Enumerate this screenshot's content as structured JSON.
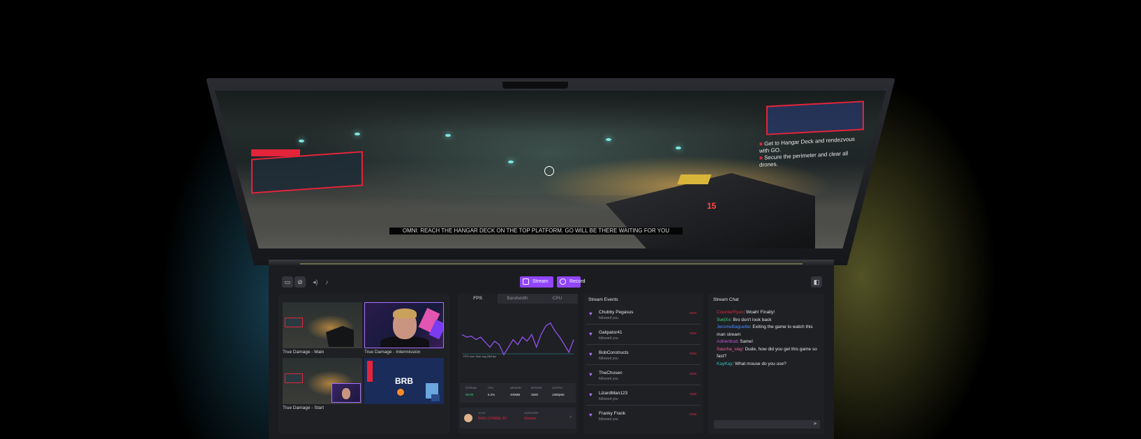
{
  "toolbar": {
    "stream_label": "Stream",
    "record_label": "Record",
    "accent": "#9146ff"
  },
  "game": {
    "hud_objectives": [
      "Get to Hangar Deck and rendezvous with GO.",
      "Secure the perimeter and clear all drones."
    ],
    "ammo": "15",
    "subtitle": "OMNI: REACH THE HANGAR DECK ON THE TOP PLATFORM. GO WILL BE THERE WAITING FOR YOU"
  },
  "scenes": [
    {
      "label": "True Damage - Main",
      "selected": false
    },
    {
      "label": "True Damage - Intermission",
      "selected": true
    },
    {
      "label": "True Damage - Start",
      "selected": false
    },
    {
      "label": "",
      "selected": false,
      "thumb_text": "BRB"
    }
  ],
  "stats": {
    "tabs": [
      "FPS",
      "Bandwidth",
      "CPU"
    ],
    "active_tab": "FPS",
    "graph_note": "FPS over time avg 288 fps",
    "fps_series": [
      0.55,
      0.5,
      0.52,
      0.45,
      0.5,
      0.4,
      0.3,
      0.42,
      0.35,
      0.15,
      0.3,
      0.45,
      0.35,
      0.5,
      0.42,
      0.55,
      0.3,
      0.55,
      0.72,
      0.78,
      0.62,
      0.5,
      0.35,
      0.2,
      0.45
    ],
    "metrics": [
      {
        "key": "Stream",
        "value": "00:00",
        "green": true
      },
      {
        "key": "CPU",
        "value": "5.2%",
        "green": false
      },
      {
        "key": "Memory",
        "value": "400MB",
        "green": false
      },
      {
        "key": "Bitrate",
        "value": "2500",
        "green": false
      },
      {
        "key": "Output",
        "value": "1080p60",
        "green": false
      }
    ],
    "info": {
      "title_key": "Title",
      "title_value": "RAID CITADEL BY",
      "category_key": "Category",
      "category_value": "Shooter"
    }
  },
  "events": {
    "title": "Stream Events",
    "items": [
      {
        "name": "Chubby Pegasus",
        "sub": "followed you",
        "time": "now"
      },
      {
        "name": "Galipator41",
        "sub": "followed you",
        "time": "now"
      },
      {
        "name": "BobConstructs",
        "sub": "followed you",
        "time": "now"
      },
      {
        "name": "TheChosen",
        "sub": "followed you",
        "time": "now"
      },
      {
        "name": "LizardMan123",
        "sub": "followed you",
        "time": "now"
      },
      {
        "name": "Franky Frank",
        "sub": "followed you",
        "time": "now"
      }
    ]
  },
  "chat": {
    "title": "Stream Chat",
    "messages": [
      {
        "user": "CounterRyan",
        "text": "Woah! Finally!",
        "color": "#e3243a"
      },
      {
        "user": "Swi|Xx",
        "text": "Bro don't look back",
        "color": "#3fd47c"
      },
      {
        "user": "JeromeBaguette",
        "text": "Exiting the game to watch this man stream",
        "color": "#4a90ff"
      },
      {
        "user": "Adrienbud",
        "text": "Same!",
        "color": "#c35bd6"
      },
      {
        "user": "Sascha_slay",
        "text": "Dude, how did you get this game so fast?",
        "color": "#ff5fa2"
      },
      {
        "user": "KayKay",
        "text": "What mouse do you use?",
        "color": "#2ec4c4"
      }
    ],
    "input_placeholder": ""
  }
}
